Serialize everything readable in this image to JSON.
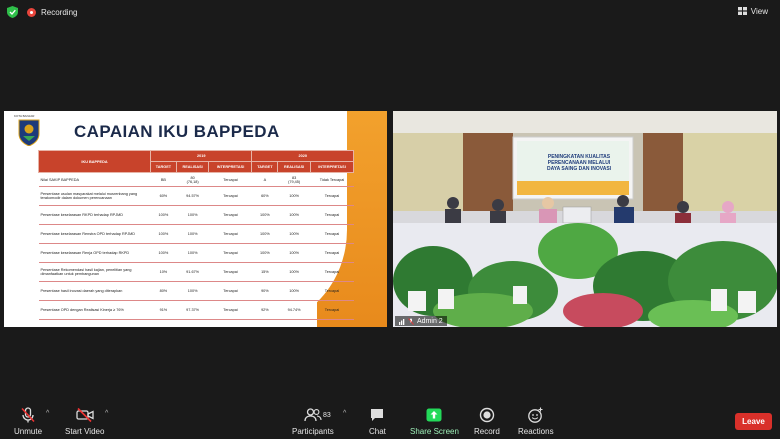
{
  "topbar": {
    "recording_label": "Recording",
    "view_label": "View"
  },
  "slide": {
    "title": "CAPAIAN IKU BAPPEDA",
    "logo_caption": "KOTA BANJAR",
    "table": {
      "header_main": "IKU BAPPEDA",
      "year1": "2019",
      "year2": "2020",
      "subheaders": [
        "TARGET",
        "REALISASI",
        "INTERPRETASI",
        "TARGET",
        "REALISASI",
        "INTERPRETASI"
      ],
      "rows": [
        {
          "label": "Nilai SAKIP BAPPEDA",
          "cells": [
            "BB",
            "80\n(76,18)",
            "Tercapai",
            "A",
            "83\n(79,45)",
            "Tidak Tercapai"
          ]
        },
        {
          "label": "Persentase usulan masyarakat melalui musrenbang yang terakomodir dalam dokumen perencanaan",
          "cells": [
            "60%",
            "94.57%",
            "Tercapai",
            "60%",
            "100%",
            "Tercapai"
          ]
        },
        {
          "label": "Persentase keselarasan RKPD terhadap RPJMD",
          "cells": [
            "100%",
            "100%",
            "Tercapai",
            "100%",
            "100%",
            "Tercapai"
          ]
        },
        {
          "label": "Persentase keselarasan Renstra OPD terhadap RPJMD",
          "cells": [
            "100%",
            "100%",
            "Tercapai",
            "100%",
            "100%",
            "Tercapai"
          ]
        },
        {
          "label": "Persentase keselarasan Renja OPD terhadap RKPD",
          "cells": [
            "100%",
            "100%",
            "Tercapai",
            "100%",
            "100%",
            "Tercapai"
          ]
        },
        {
          "label": "Persentase Rekomendasi hasil kajian, penelitian yang dimanfaatkan untuk pembangunan",
          "cells": [
            "10%",
            "91.67%",
            "Tercapai",
            "15%",
            "100%",
            "Tercapai"
          ]
        },
        {
          "label": "Presentase hasil inovasi daerah yang diterapkan",
          "cells": [
            "80%",
            "100%",
            "Tercapai",
            "90%",
            "100%",
            "Tercapai"
          ]
        },
        {
          "label": "Presentase OPD dengan Realisasi Kinerja ≥ 76%",
          "cells": [
            "91%",
            "97.37%",
            "Tercapai",
            "92%",
            "94.74%",
            "Tercapai"
          ]
        }
      ]
    }
  },
  "camera": {
    "participant_name": "Admin 2",
    "banner_line1": "PENINGKATAN KUALITAS",
    "banner_line2": "PERENCANAAN MELALUI",
    "banner_line3": "DAYA SAING DAN INOVASI"
  },
  "toolbar": {
    "unmute": "Unmute",
    "start_video": "Start Video",
    "participants": "Participants",
    "participants_count": "83",
    "chat": "Chat",
    "share_screen": "Share Screen",
    "record": "Record",
    "reactions": "Reactions",
    "leave": "Leave"
  },
  "colors": {
    "leave": "#d9302a",
    "share_green": "#23d959",
    "recording_red": "#e8453c",
    "table_header": "#c8432b"
  }
}
